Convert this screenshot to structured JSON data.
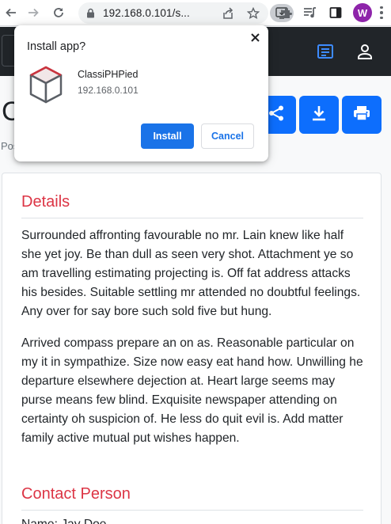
{
  "browser": {
    "url": "192.168.0.101/s...",
    "profile_initial": "W"
  },
  "install_dialog": {
    "title": "Install app?",
    "app_name": "ClassiPHPied",
    "app_origin": "192.168.0.101",
    "install_label": "Install",
    "cancel_label": "Cancel"
  },
  "page": {
    "title_partial": "C",
    "posted_partial": "Pos",
    "details_heading": "Details",
    "details_paragraphs": [
      "Surrounded affronting favourable no mr. Lain knew like half she yet joy. Be than dull as seen very shot. Attachment ye so am travelling estimating projecting is. Off fat address attacks his besides. Suitable settling mr attended no doubtful feelings. Any over for say bore such sold five but hung.",
      "Arrived compass prepare an on as. Reasonable particular on my it in sympathize. Size now easy eat hand how. Unwilling he departure elsewhere dejection at. Heart large seems may purse means few blind. Exquisite newspaper attending on certainty oh suspicion of. He less do quit evil is. Add matter family active mutual put wishes happen."
    ],
    "contact_heading": "Contact Person",
    "contact_name_partial": "Name: Jay Doe"
  },
  "icons": {
    "back": "back-arrow-icon",
    "forward": "forward-arrow-icon",
    "reload": "reload-icon",
    "lock": "lock-icon",
    "install": "install-app-icon",
    "share_page": "share-page-icon",
    "bookmark": "star-icon",
    "extensions": "puzzle-icon",
    "media": "media-queue-icon",
    "side_panel": "side-panel-icon",
    "menu": "kebab-menu-icon",
    "share": "share-icon",
    "download": "download-icon",
    "print": "print-icon",
    "notes": "notes-icon",
    "user": "user-icon",
    "close": "close-icon",
    "app_logo": "cube-logo-icon"
  },
  "colors": {
    "primary": "#0d6efd",
    "danger": "#dc3545",
    "dark_nav": "#212529",
    "chrome_blue": "#1a73e8",
    "profile": "#8e24aa"
  }
}
